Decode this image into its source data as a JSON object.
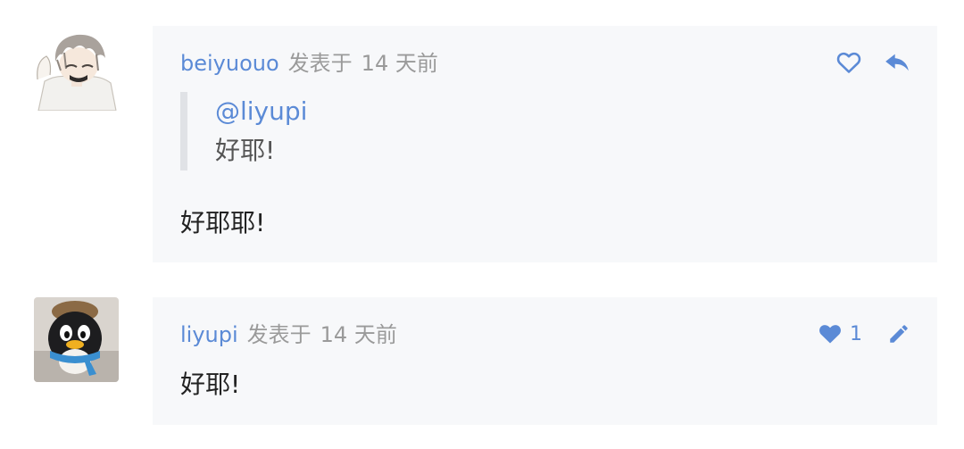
{
  "comments": [
    {
      "author": "beiyuouo",
      "posted_label": "发表于",
      "time": "14 天前",
      "quote": {
        "mention": "@liyupi",
        "text": "好耶!"
      },
      "body": "好耶耶!",
      "avatar_icon": "anime-boy-avatar",
      "actions": [
        "heart-outline-icon",
        "reply-icon"
      ]
    },
    {
      "author": "liyupi",
      "posted_label": "发表于",
      "time": "14 天前",
      "body": "好耶!",
      "like_count": "1",
      "avatar_icon": "penguin-toy-avatar",
      "actions": [
        "heart-filled-icon",
        "edit-icon"
      ]
    }
  ],
  "colors": {
    "accent": "#5b8ad6",
    "card_bg": "#f7f8fa",
    "muted": "#9a9a9a"
  }
}
